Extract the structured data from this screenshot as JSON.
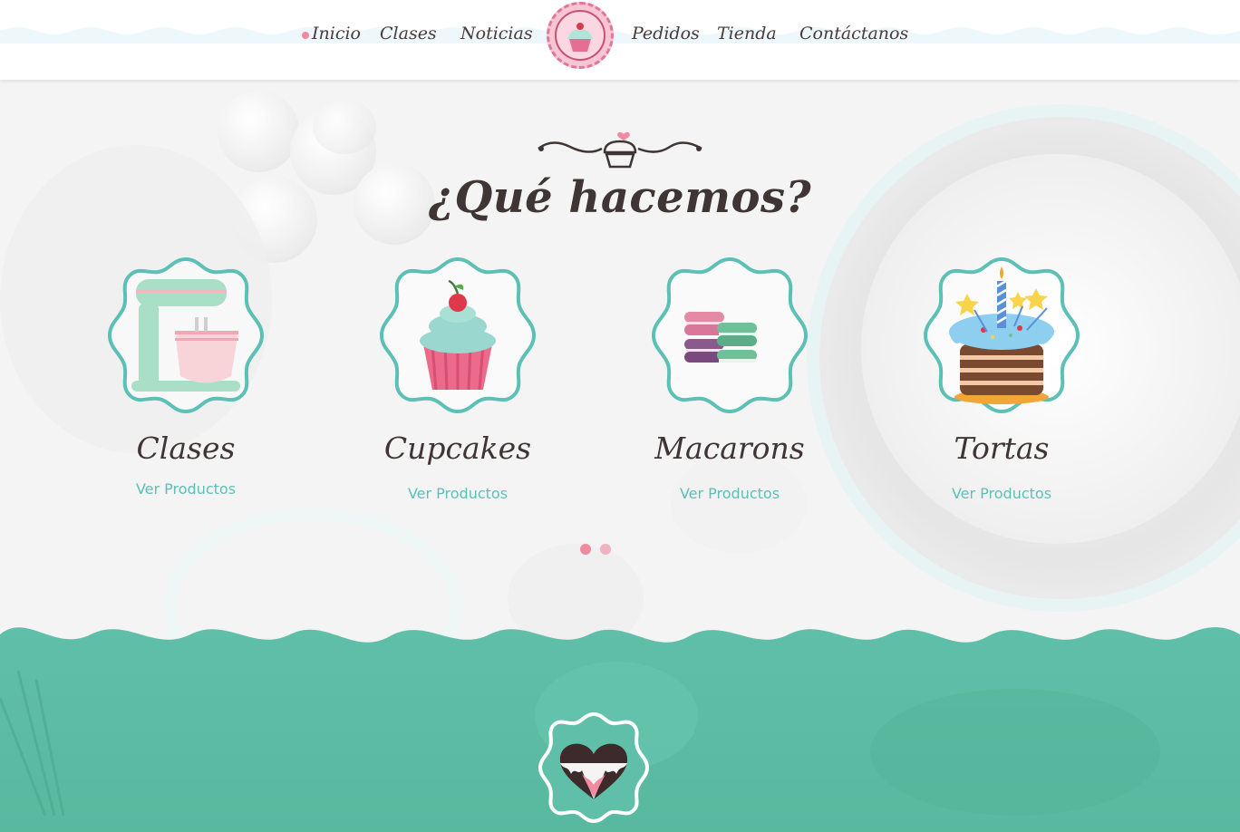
{
  "nav": {
    "items": [
      {
        "label": "Inicio"
      },
      {
        "label": "Clases"
      },
      {
        "label": "Noticias"
      },
      {
        "label": "Pedidos"
      },
      {
        "label": "Tienda"
      },
      {
        "label": "Contáctanos"
      }
    ],
    "logo_icon": "pretty-cupcake-logo"
  },
  "main": {
    "title": "¿Qué hacemos?",
    "ornament_icon": "cupcake-ornament-icon",
    "cards": [
      {
        "title": "Clases",
        "link": "Ver Productos",
        "icon": "stand-mixer-icon"
      },
      {
        "title": "Cupcakes",
        "link": "Ver Productos",
        "icon": "cupcake-icon"
      },
      {
        "title": "Macarons",
        "link": "Ver Productos",
        "icon": "macarons-icon"
      },
      {
        "title": "Tortas",
        "link": "Ver Productos",
        "icon": "birthday-cake-icon"
      }
    ],
    "carousel_pages": 2,
    "carousel_active": 0
  },
  "footer_section": {
    "badge_icon": "chocolate-heart-icon"
  },
  "colors": {
    "accent_teal": "#5cc0b6",
    "accent_pink": "#ef8aa1",
    "green_band": "#5cbfa8",
    "text_dark": "#3f3535"
  }
}
